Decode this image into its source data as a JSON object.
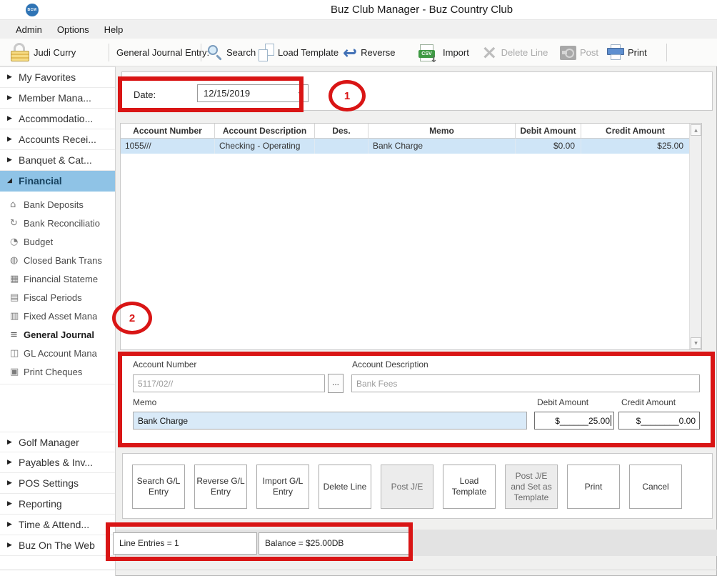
{
  "window": {
    "title": "Buz Club Manager - Buz Country Club",
    "logo_text": "BCM"
  },
  "menu": {
    "items": [
      {
        "label": "Admin"
      },
      {
        "label": "Options"
      },
      {
        "label": "Help"
      }
    ]
  },
  "toolbar": {
    "user_label": "Judi Curry",
    "context_label": "General Journal Entry:",
    "search_label": "Search",
    "load_template_label": "Load Template",
    "reverse_label": "Reverse",
    "import_label": "Import",
    "import_icon_text": "CSV",
    "delete_line_label": "Delete Line",
    "post_label": "Post",
    "print_label": "Print"
  },
  "sidebar": {
    "top_items": [
      {
        "label": "My Favorites"
      },
      {
        "label": "Member Mana..."
      },
      {
        "label": "Accommodatio..."
      },
      {
        "label": "Accounts Recei..."
      },
      {
        "label": "Banquet & Cat..."
      },
      {
        "label": "Financial",
        "selected": true
      }
    ],
    "financial_children": [
      {
        "label": "Bank Deposits",
        "icon": "⌂"
      },
      {
        "label": "Bank Reconciliatio",
        "icon": "↻"
      },
      {
        "label": "Budget",
        "icon": "◔"
      },
      {
        "label": "Closed Bank Trans",
        "icon": "◍"
      },
      {
        "label": "Financial Stateme",
        "icon": "▦"
      },
      {
        "label": "Fiscal Periods",
        "icon": "▤"
      },
      {
        "label": "Fixed Asset Mana",
        "icon": "▥"
      },
      {
        "label": "General Journal",
        "icon": "≡",
        "selected": true
      },
      {
        "label": "GL Account Mana",
        "icon": "◫"
      },
      {
        "label": "Print Cheques",
        "icon": "▣"
      }
    ],
    "bottom_items": [
      {
        "label": "Golf Manager"
      },
      {
        "label": "Payables & Inv..."
      },
      {
        "label": "POS Settings"
      },
      {
        "label": "Reporting"
      },
      {
        "label": "Time & Attend..."
      },
      {
        "label": "Buz On The Web"
      }
    ]
  },
  "main": {
    "date_label": "Date:",
    "date_value": "12/15/2019",
    "table": {
      "columns": [
        "Account Number",
        "Account Description",
        "Des.",
        "Memo",
        "Debit Amount",
        "Credit Amount"
      ],
      "rows": [
        {
          "account_number": "1055///",
          "account_description": "Checking - Operating",
          "des": "",
          "memo": "Bank Charge",
          "debit": "$0.00",
          "credit": "$25.00"
        }
      ]
    },
    "form": {
      "account_number_label": "Account Number",
      "account_number_value": "5117/02//",
      "browse_label": "...",
      "account_description_label": "Account Description",
      "account_description_value": "Bank Fees",
      "memo_label": "Memo",
      "memo_value": "Bank Charge",
      "debit_label": "Debit Amount",
      "debit_value": "$______25.00",
      "credit_label": "Credit Amount",
      "credit_value": "$________0.00"
    },
    "action_buttons": [
      {
        "label": "Search G/L Entry"
      },
      {
        "label": "Reverse G/L Entry"
      },
      {
        "label": "Import G/L Entry"
      },
      {
        "label": "Delete Line"
      },
      {
        "label": "Post J/E",
        "disabled": true
      },
      {
        "label": "Load Template"
      },
      {
        "label": "Post J/E and Set as Template",
        "disabled": true
      },
      {
        "label": "Print"
      },
      {
        "label": "Cancel"
      }
    ],
    "status": {
      "line_entries": "Line Entries = 1",
      "balance": "Balance = $25.00DB"
    }
  },
  "icons": {
    "scroll_up": "▲",
    "scroll_down": "▼",
    "combo_arrow": "▼",
    "collapsed_arrow": "▶",
    "expanded_arrow": "◢",
    "reverse_arrow": "↩",
    "import_arrow": "↓",
    "delete_x": "×"
  },
  "annotations": {
    "color": "#d91515",
    "step1": "1",
    "step2": "2"
  },
  "colors": {
    "annotation_red": "#d91515",
    "nav_selection_blue": "#8fc3e6",
    "row_selection_blue": "#cfe5f7",
    "memo_field_blue": "#d9eaf8"
  }
}
